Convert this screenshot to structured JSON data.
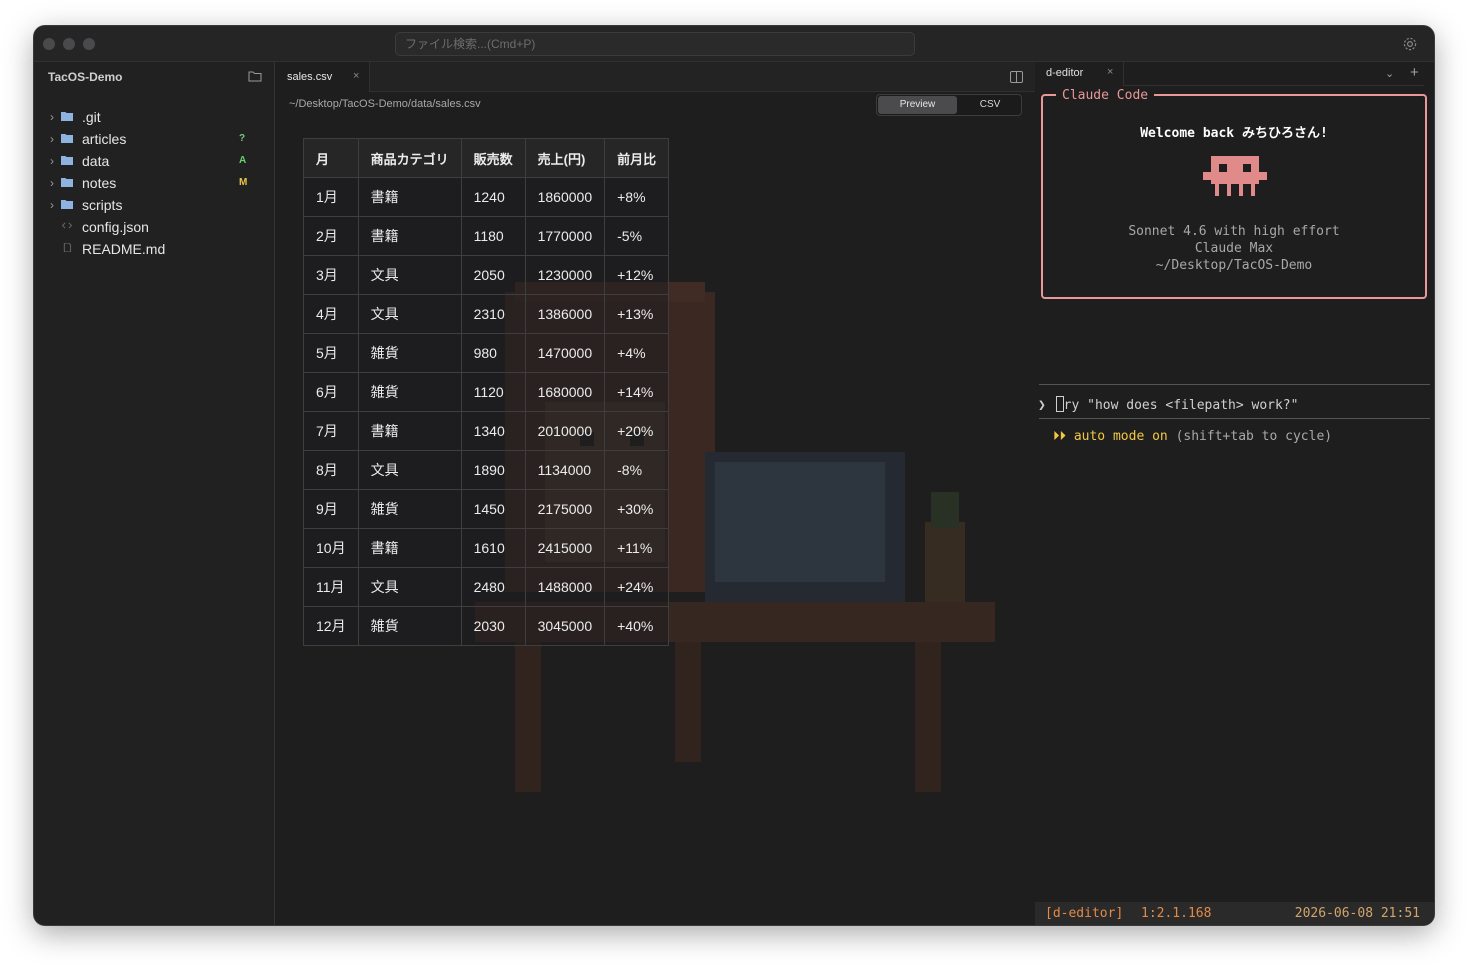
{
  "titlebar": {
    "search_placeholder": "ファイル検索...(Cmd+P)"
  },
  "sidebar": {
    "project": "TacOS-Demo",
    "items": [
      {
        "name": ".git",
        "type": "folder",
        "status": ""
      },
      {
        "name": "articles",
        "type": "folder",
        "status": "?"
      },
      {
        "name": "data",
        "type": "folder",
        "status": "A"
      },
      {
        "name": "notes",
        "type": "folder",
        "status": "M"
      },
      {
        "name": "scripts",
        "type": "folder",
        "status": ""
      },
      {
        "name": "config.json",
        "type": "file",
        "status": ""
      },
      {
        "name": "README.md",
        "type": "file",
        "status": ""
      }
    ],
    "status_colors": {
      "?": "#7ec77e",
      "A": "#6bd16b",
      "M": "#e8c84a"
    }
  },
  "editor": {
    "tab": {
      "label": "sales.csv",
      "close": "×"
    },
    "path": "~/Desktop/TacOS-Demo/data/sales.csv",
    "view_toggle": {
      "preview": "Preview",
      "csv": "CSV",
      "active": "Preview"
    },
    "table": {
      "headers": [
        "月",
        "商品カテゴリ",
        "販売数",
        "売上(円)",
        "前月比"
      ],
      "rows": [
        [
          "1月",
          "書籍",
          "1240",
          "1860000",
          "+8%"
        ],
        [
          "2月",
          "書籍",
          "1180",
          "1770000",
          "-5%"
        ],
        [
          "3月",
          "文具",
          "2050",
          "1230000",
          "+12%"
        ],
        [
          "4月",
          "文具",
          "2310",
          "1386000",
          "+13%"
        ],
        [
          "5月",
          "雑貨",
          "980",
          "1470000",
          "+4%"
        ],
        [
          "6月",
          "雑貨",
          "1120",
          "1680000",
          "+14%"
        ],
        [
          "7月",
          "書籍",
          "1340",
          "2010000",
          "+20%"
        ],
        [
          "8月",
          "文具",
          "1890",
          "1134000",
          "-8%"
        ],
        [
          "9月",
          "雑貨",
          "1450",
          "2175000",
          "+30%"
        ],
        [
          "10月",
          "書籍",
          "1610",
          "2415000",
          "+11%"
        ],
        [
          "11月",
          "文具",
          "2480",
          "1488000",
          "+24%"
        ],
        [
          "12月",
          "雑貨",
          "2030",
          "3045000",
          "+40%"
        ]
      ]
    }
  },
  "terminal": {
    "tab": {
      "label": "d-editor",
      "close": "×",
      "dropdown": "⌄",
      "add": "+"
    },
    "box": {
      "title": "Claude Code",
      "welcome": "Welcome back みちひろさん!",
      "model": "Sonnet 4.6 with high effort",
      "plan": "Claude Max",
      "cwd": "~/Desktop/TacOS-Demo"
    },
    "prompt": {
      "symbol": "❯",
      "placeholder": "ry \"how does <filepath> work?\""
    },
    "auto_mode": {
      "arrows": "⏵⏵",
      "label": "auto mode on",
      "hint": "(shift+tab to cycle)"
    },
    "statusbar": {
      "session": "[d-editor]",
      "pane": "1:2.1.168",
      "datetime": "2026-06-08 21:51"
    }
  }
}
